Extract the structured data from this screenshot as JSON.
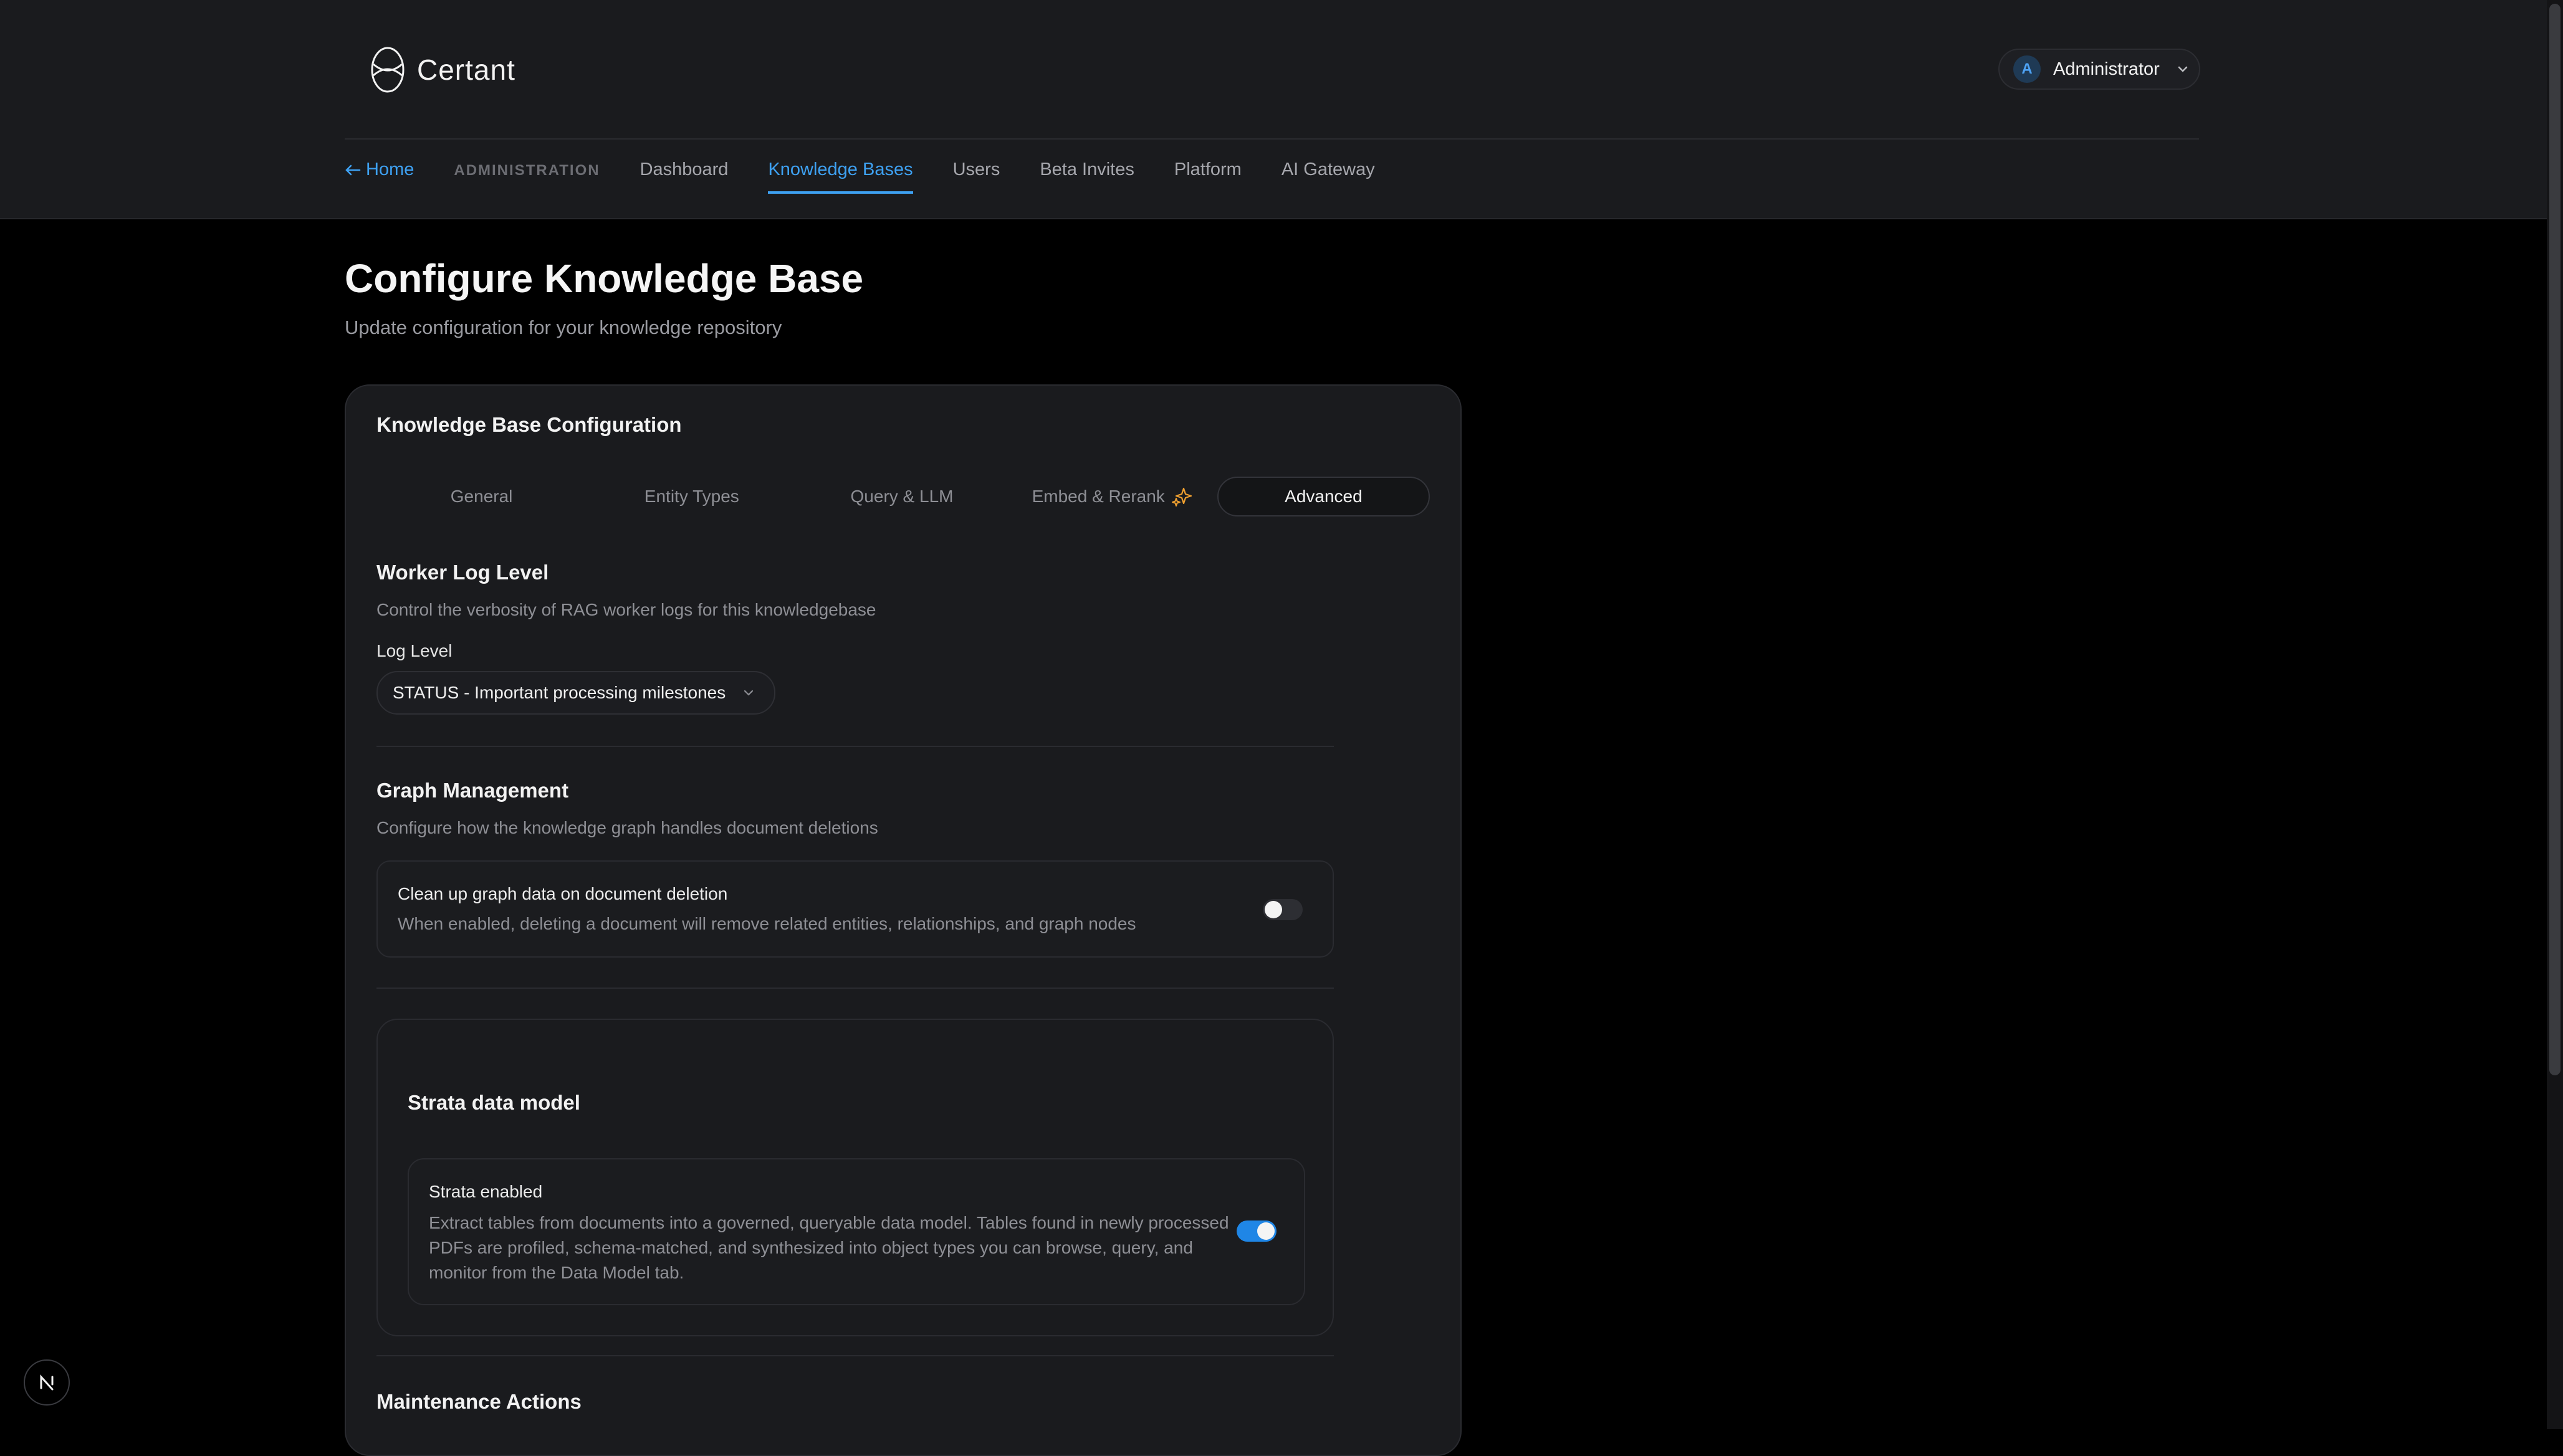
{
  "app": {
    "brand": "Certant"
  },
  "user": {
    "initial": "A",
    "name": "Administrator"
  },
  "nav": {
    "home": "Home",
    "section": "ADMINISTRATION",
    "items": [
      "Dashboard",
      "Knowledge Bases",
      "Users",
      "Beta Invites",
      "Platform",
      "AI Gateway"
    ],
    "active": "Knowledge Bases"
  },
  "page": {
    "title": "Configure Knowledge Base",
    "subtitle": "Update configuration for your knowledge repository"
  },
  "card": {
    "title": "Knowledge Base Configuration",
    "tabs": [
      "General",
      "Entity Types",
      "Query & LLM",
      "Embed & Rerank",
      "Advanced"
    ],
    "active_tab": "Advanced"
  },
  "worker_log": {
    "title": "Worker Log Level",
    "description": "Control the verbosity of RAG worker logs for this knowledgebase",
    "field_label": "Log Level",
    "selected": "STATUS - Important processing milestones"
  },
  "graph": {
    "title": "Graph Management",
    "description": "Configure how the knowledge graph handles document deletions",
    "option_title": "Clean up graph data on document deletion",
    "option_desc": "When enabled, deleting a document will remove related entities, relationships, and graph nodes",
    "enabled": false
  },
  "strata": {
    "title": "Strata data model",
    "option_title": "Strata enabled",
    "option_desc": "Extract tables from documents into a governed, queryable data model. Tables found in newly processed PDFs are profiled, schema-matched, and synthesized into object types you can browse, query, and monitor from the Data Model tab.",
    "enabled": true
  },
  "maintenance": {
    "title": "Maintenance Actions"
  },
  "colors": {
    "accent": "#3ea1f2",
    "toggle_on": "#1f86e6",
    "sparkle": "#f0a030"
  }
}
